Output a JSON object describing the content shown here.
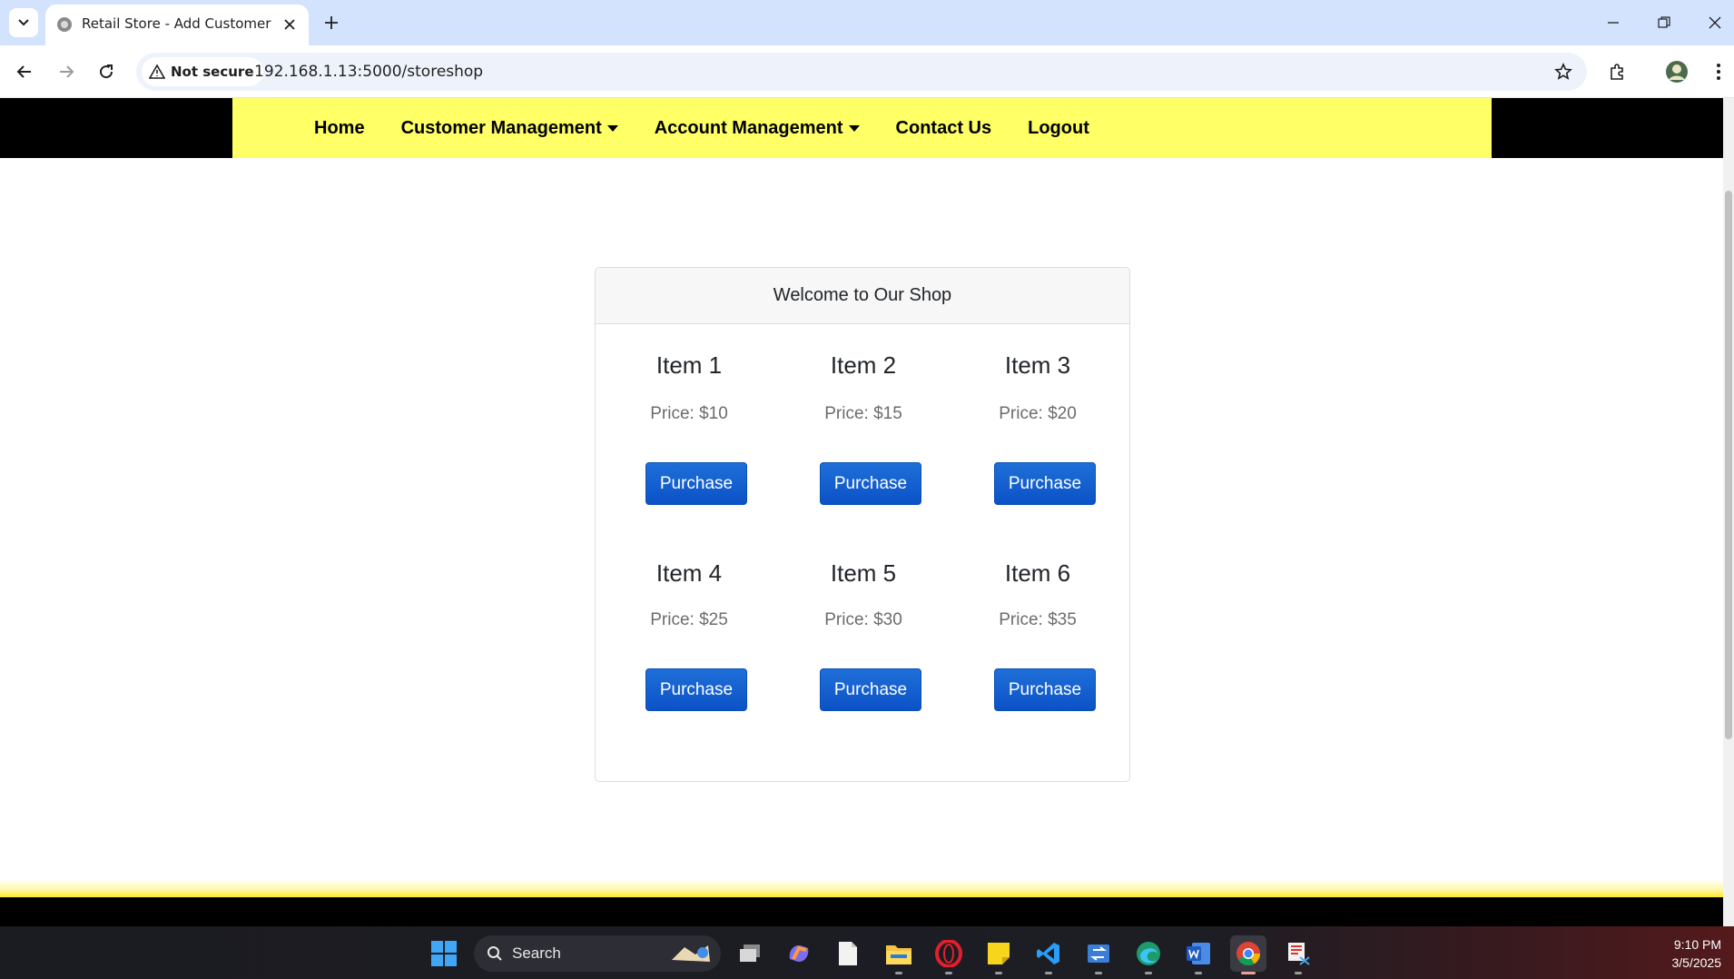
{
  "browser": {
    "tab_title": "Retail Store - Add Customer",
    "security_label": "Not secure",
    "url": "192.168.1.13:5000/storeshop"
  },
  "nav": {
    "items": [
      {
        "label": "Home",
        "dropdown": false
      },
      {
        "label": "Customer Management",
        "dropdown": true
      },
      {
        "label": "Account Management",
        "dropdown": true
      },
      {
        "label": "Contact Us",
        "dropdown": false
      },
      {
        "label": "Logout",
        "dropdown": false
      }
    ],
    "background_color": "#ffff66"
  },
  "shop": {
    "header": "Welcome to Our Shop",
    "button_label": "Purchase",
    "items": [
      {
        "name": "Item 1",
        "price": "Price: $10"
      },
      {
        "name": "Item 2",
        "price": "Price: $15"
      },
      {
        "name": "Item 3",
        "price": "Price: $20"
      },
      {
        "name": "Item 4",
        "price": "Price: $25"
      },
      {
        "name": "Item 5",
        "price": "Price: $30"
      },
      {
        "name": "Item 6",
        "price": "Price: $35"
      }
    ]
  },
  "taskbar": {
    "search_label": "Search",
    "time": "9:10 PM",
    "date": "3/5/2025"
  }
}
